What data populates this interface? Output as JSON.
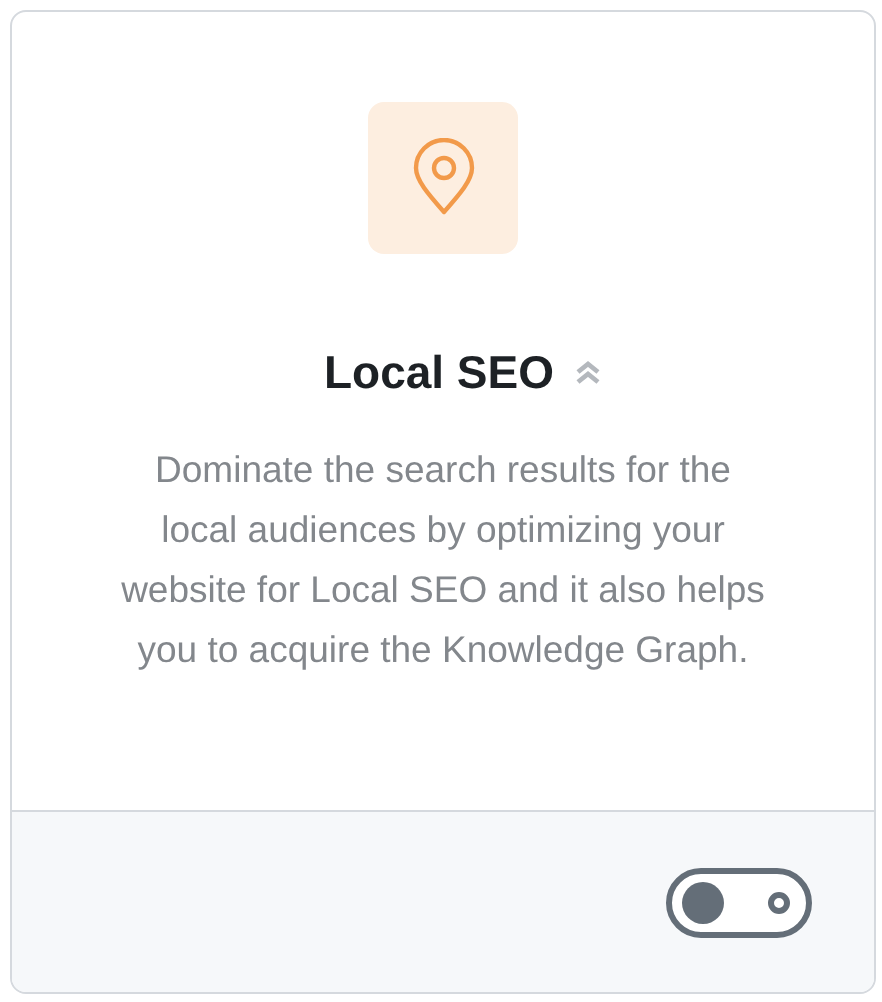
{
  "card": {
    "title": "Local SEO",
    "description": "Dominate the search results for the local audiences by optimizing your website for Local SEO and it also helps you to acquire the Knowledge Graph.",
    "toggle": {
      "on": false
    }
  }
}
